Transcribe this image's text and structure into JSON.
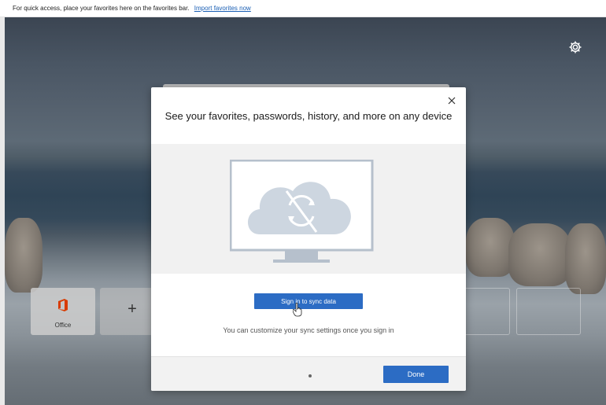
{
  "favorites_bar": {
    "message": "For quick access, place your favorites here on the favorites bar.",
    "import_link": "Import favorites now"
  },
  "new_tab": {
    "settings_icon": "gear-icon",
    "tiles": [
      {
        "label": "Office",
        "icon": "office-icon"
      },
      {
        "label": "",
        "icon": "plus-icon",
        "glyph": "+"
      }
    ]
  },
  "dialog": {
    "title": "See your favorites, passwords, history, and more on any device",
    "illustration_icon": "monitor-cloud-sync-off-icon",
    "sign_in_label": "Sign in to sync data",
    "note": "You can customize your sync settings once you sign in",
    "done_label": "Done",
    "page_indicator_icon": "dot-icon"
  },
  "colors": {
    "accent": "#2c6cc4",
    "office_red": "#d83b01"
  }
}
